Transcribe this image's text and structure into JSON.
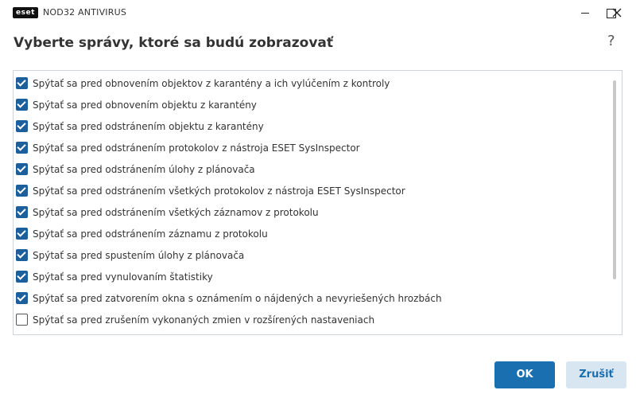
{
  "window": {
    "brand": "eset",
    "app_name": "NOD32 ANTIVIRUS"
  },
  "header": {
    "title": "Vyberte správy, ktoré sa budú zobrazovať",
    "help_symbol": "?"
  },
  "messages": [
    {
      "label": "Spýtať sa pred obnovením objektov z karantény a ich vylúčením z kontroly",
      "checked": true
    },
    {
      "label": "Spýtať sa pred obnovením objektu z karantény",
      "checked": true
    },
    {
      "label": "Spýtať sa pred odstránením objektu z karantény",
      "checked": true
    },
    {
      "label": "Spýtať sa pred odstránením protokolov z nástroja ESET SysInspector",
      "checked": true
    },
    {
      "label": "Spýtať sa pred odstránením úlohy z plánovača",
      "checked": true
    },
    {
      "label": "Spýtať sa pred odstránením všetkých protokolov z nástroja ESET SysInspector",
      "checked": true
    },
    {
      "label": "Spýtať sa pred odstránením všetkých záznamov z protokolu",
      "checked": true
    },
    {
      "label": "Spýtať sa pred odstránením záznamu z protokolu",
      "checked": true
    },
    {
      "label": "Spýtať sa pred spustením úlohy z plánovača",
      "checked": true
    },
    {
      "label": "Spýtať sa pred vynulovaním štatistiky",
      "checked": true
    },
    {
      "label": "Spýtať sa pred zatvorením okna s oznámením o nájdených a nevyriešených hrozbách",
      "checked": true
    },
    {
      "label": "Spýtať sa pred zrušením vykonaných zmien v rozšírených nastaveniach",
      "checked": false
    },
    {
      "label": "",
      "checked": true
    }
  ],
  "footer": {
    "ok_label": "OK",
    "cancel_label": "Zrušiť"
  },
  "colors": {
    "accent": "#1a6fb0",
    "checkbox": "#1d5f9a",
    "cancel_bg": "#d8e6f1"
  }
}
